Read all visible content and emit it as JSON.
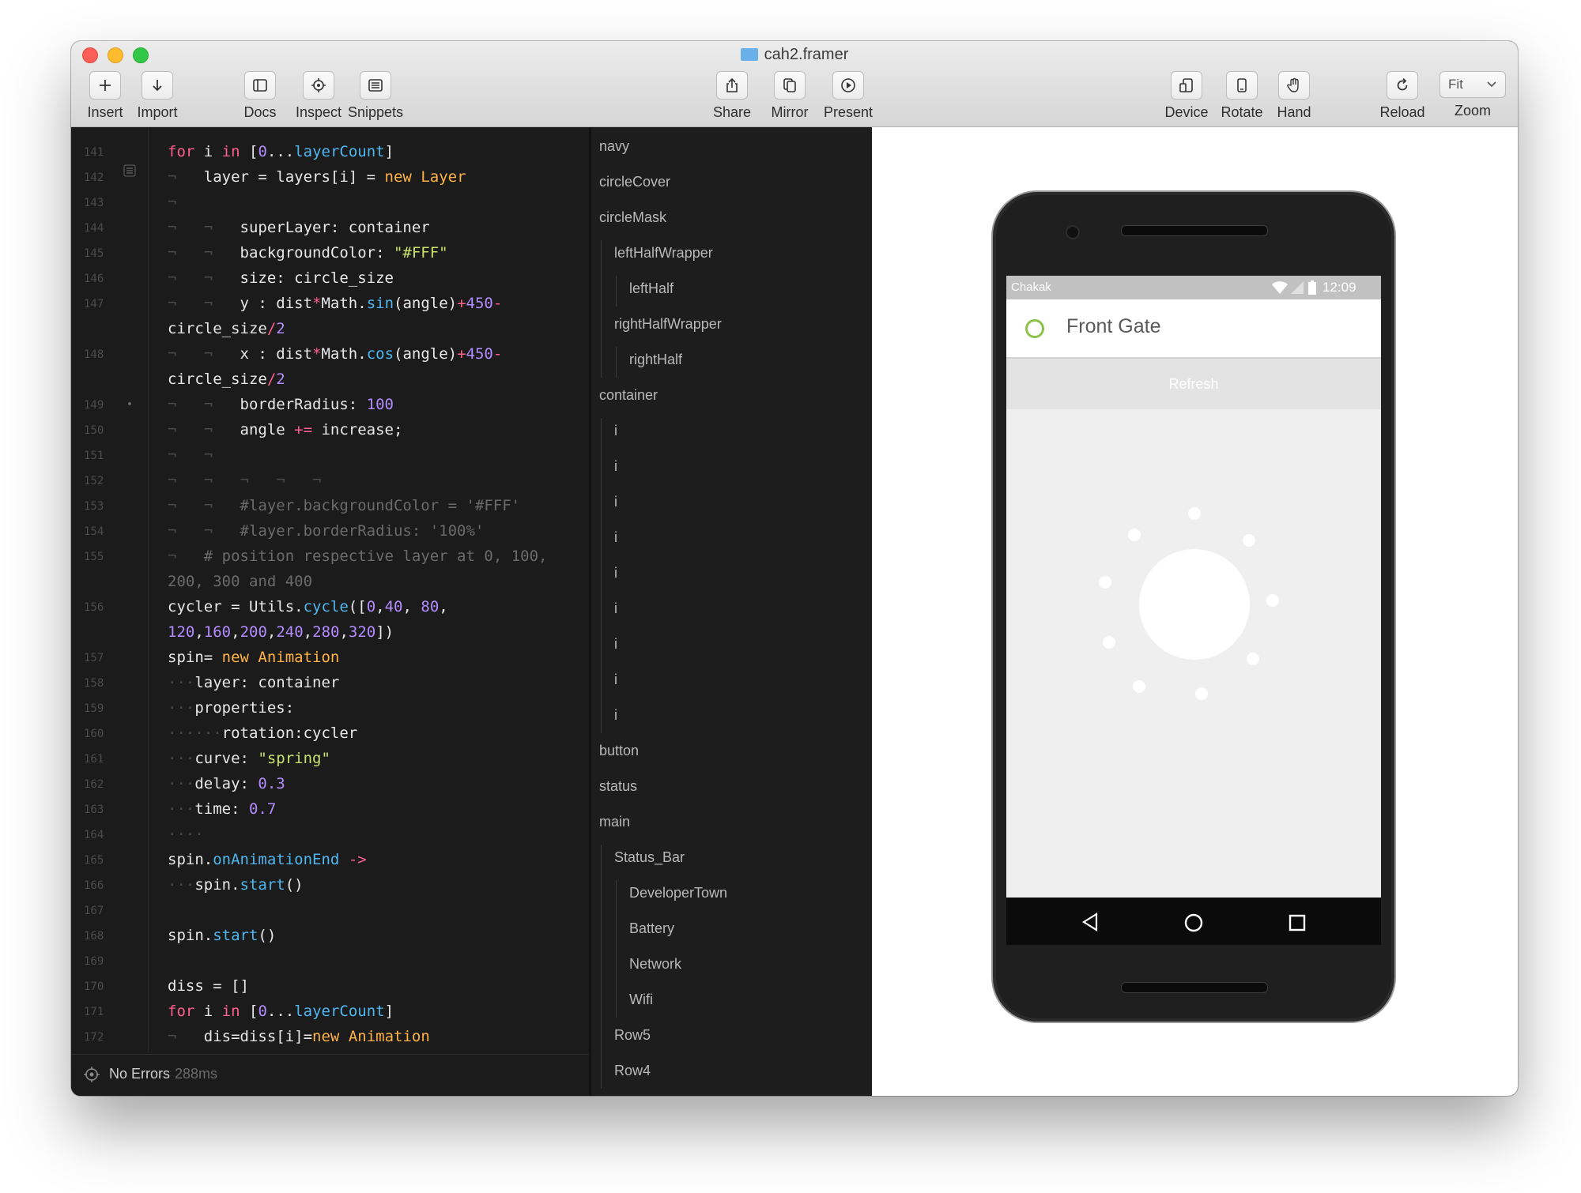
{
  "window": {
    "title": "cah2.framer"
  },
  "toolbar": {
    "insert": "Insert",
    "import": "Import",
    "docs": "Docs",
    "inspect": "Inspect",
    "snippets": "Snippets",
    "share": "Share",
    "mirror": "Mirror",
    "present": "Present",
    "device": "Device",
    "rotate": "Rotate",
    "hand": "Hand",
    "reload": "Reload",
    "zoom": "Zoom",
    "zoom_value": "Fit"
  },
  "editor": {
    "line_numbers": [
      "141",
      "142",
      "143",
      "144",
      "145",
      "146",
      "147",
      "",
      "148",
      "",
      "149",
      "150",
      "151",
      "152",
      "153",
      "154",
      "155",
      "",
      "156",
      "",
      "157",
      "158",
      "159",
      "160",
      "161",
      "162",
      "163",
      "164",
      "165",
      "166",
      "167",
      "168",
      "169",
      "170",
      "171",
      "172"
    ],
    "status": "No Errors",
    "status_time": "288ms"
  },
  "layers": {
    "items": [
      {
        "label": "navy",
        "depth": 0
      },
      {
        "label": "circleCover",
        "depth": 0
      },
      {
        "label": "circleMask",
        "depth": 0
      },
      {
        "label": "leftHalfWrapper",
        "depth": 1
      },
      {
        "label": "leftHalf",
        "depth": 2
      },
      {
        "label": "rightHalfWrapper",
        "depth": 1
      },
      {
        "label": "rightHalf",
        "depth": 2
      },
      {
        "label": "container",
        "depth": 0
      },
      {
        "label": "i",
        "depth": 1
      },
      {
        "label": "i",
        "depth": 1
      },
      {
        "label": "i",
        "depth": 1
      },
      {
        "label": "i",
        "depth": 1
      },
      {
        "label": "i",
        "depth": 1
      },
      {
        "label": "i",
        "depth": 1
      },
      {
        "label": "i",
        "depth": 1
      },
      {
        "label": "i",
        "depth": 1
      },
      {
        "label": "i",
        "depth": 1
      },
      {
        "label": "button",
        "depth": 0
      },
      {
        "label": "status",
        "depth": 0
      },
      {
        "label": "main",
        "depth": 0
      },
      {
        "label": "Status_Bar",
        "depth": 1
      },
      {
        "label": "DeveloperTown",
        "depth": 2
      },
      {
        "label": "Battery",
        "depth": 2
      },
      {
        "label": "Network",
        "depth": 2
      },
      {
        "label": "Wifi",
        "depth": 2
      },
      {
        "label": "Row5",
        "depth": 1
      },
      {
        "label": "Row4",
        "depth": 1
      }
    ]
  },
  "device": {
    "carrier": "Chakak",
    "time": "12:09",
    "app_title": "Front Gate",
    "refresh_label": "Refresh",
    "accent": "#8bc34a"
  }
}
